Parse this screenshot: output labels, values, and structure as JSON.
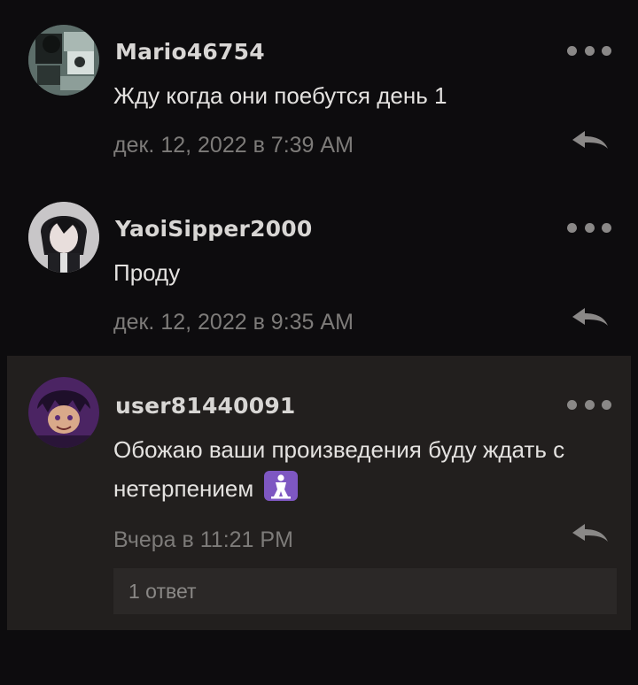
{
  "comments": [
    {
      "username": "Mario46754",
      "text": "Жду когда они поебутся день 1",
      "timestamp": "дек. 12, 2022 в 7:39 AM",
      "avatar_icon": "avatar-anime-collage"
    },
    {
      "username": "YaoiSipper2000",
      "text": "Проду",
      "timestamp": "дек. 12, 2022 в 9:35 AM",
      "avatar_icon": "avatar-dark-haired-character"
    },
    {
      "username": "user81440091",
      "text": "Обожаю ваши произведения буду ждать с нетерпением",
      "emoji": "🛐",
      "timestamp": "Вчера в 11:21 PM",
      "avatar_icon": "avatar-purple-character",
      "replies_label": "1 ответ",
      "highlighted": true
    }
  ],
  "colors": {
    "background": "#0d0c0e",
    "highlight_background": "#221f1e",
    "username": "#d8d6d4",
    "text": "#e4e2e0",
    "timestamp": "#7d7b79",
    "icon": "#8a8887",
    "emoji_purple": "#7e57c2"
  }
}
